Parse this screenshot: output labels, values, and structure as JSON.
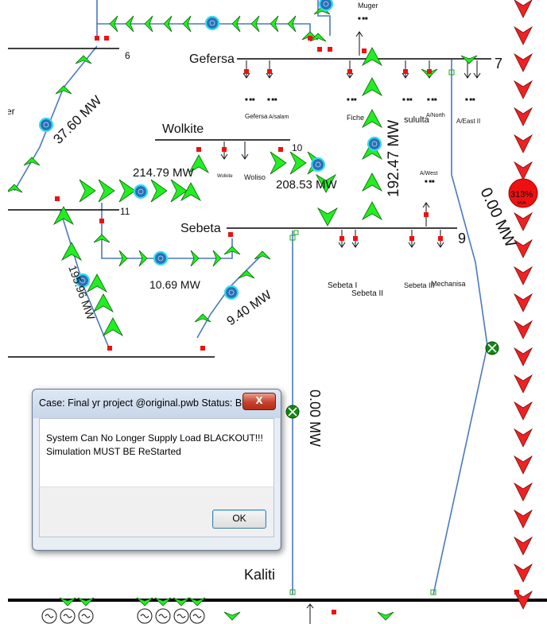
{
  "dialog": {
    "title": "Case: Final yr project @original.pwb  Status: Blackout | Si...",
    "close_label": "X",
    "message": "System Can No Longer Supply Load BLACKOUT!!! Simulation MUST BE ReStarted",
    "ok_label": "OK"
  },
  "diagram": {
    "buses": {
      "gefersa": "Gefersa",
      "wolkite": "Wolkite",
      "sebeta": "Sebeta",
      "kaliti": "Kaliti",
      "muger": "Muger"
    },
    "bus_numbers": {
      "b6": "6",
      "b7": "7",
      "b9": "9",
      "b10": "10",
      "b11": "11"
    },
    "loads": {
      "gefersa": "Gefersa",
      "alsalam": "A/salam",
      "fiche": "Fiche",
      "sululta": "sululta",
      "anorth": "A/North",
      "aeast2": "A/East II",
      "wolkite": "Wolkite",
      "woliso": "Woliso",
      "awest": "A/West",
      "sebeta1": "Sebeta I",
      "sebeta2": "Sebeta II",
      "sebeta3": "Sebeta III",
      "mechanisa": "Mechanisa"
    },
    "flows": {
      "f1": "37.60 MW",
      "f2": "214.79 MW",
      "f3": "208.53 MW",
      "f4": "192.47 MW",
      "f5": "10.69 MW",
      "f6": "9.40 MW",
      "f7": "195.96 MW",
      "f8": "0.00 MW",
      "f9": "0.00 MW"
    },
    "overload": "313%",
    "overload_unit": "MVA",
    "partial_left": "er"
  },
  "colors": {
    "arrow_green": "#22ee22",
    "arrow_red": "#ee2222",
    "line_blue": "#4a78c2",
    "pie_cyan": "#33ddee",
    "breaker_red": "#ee1111",
    "open_breaker_green": "#22aa22"
  }
}
